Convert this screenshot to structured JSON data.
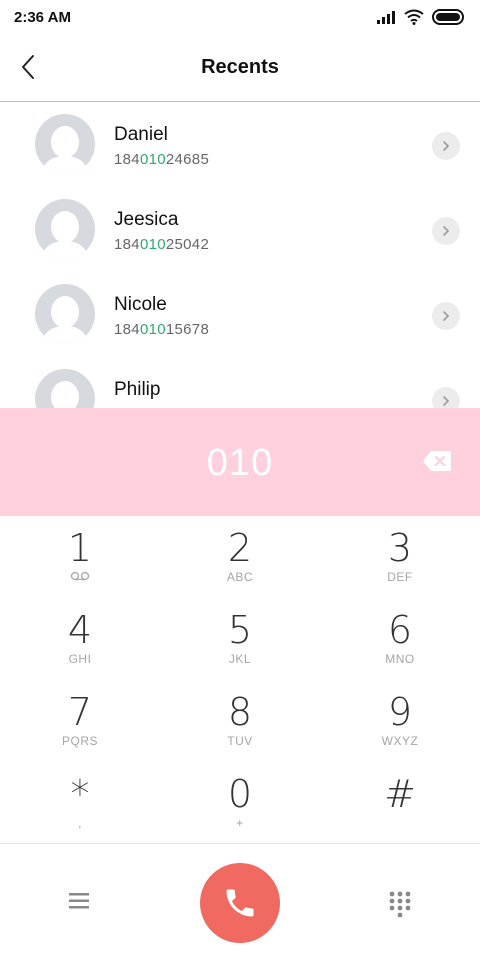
{
  "status_bar": {
    "time": "2:36 AM"
  },
  "header": {
    "title": "Recents"
  },
  "contacts": [
    {
      "name": "Daniel",
      "number_pre": "184",
      "number_match": "010",
      "number_post": "24685"
    },
    {
      "name": "Jeesica",
      "number_pre": "184",
      "number_match": "010",
      "number_post": "25042"
    },
    {
      "name": "Nicole",
      "number_pre": "184",
      "number_match": "010",
      "number_post": "15678"
    },
    {
      "name": "Philip",
      "number_pre": "",
      "number_match": "",
      "number_post": ""
    }
  ],
  "dial": {
    "number": "010"
  },
  "keypad": [
    {
      "digit": "1",
      "letters": ""
    },
    {
      "digit": "2",
      "letters": "ABC"
    },
    {
      "digit": "3",
      "letters": "DEF"
    },
    {
      "digit": "4",
      "letters": "GHI"
    },
    {
      "digit": "5",
      "letters": "JKL"
    },
    {
      "digit": "6",
      "letters": "MNO"
    },
    {
      "digit": "7",
      "letters": "PQRS"
    },
    {
      "digit": "8",
      "letters": "TUV"
    },
    {
      "digit": "9",
      "letters": "WXYZ"
    },
    {
      "digit": "*",
      "letters": ","
    },
    {
      "digit": "0",
      "letters": "+"
    },
    {
      "digit": "#",
      "letters": ""
    }
  ],
  "colors": {
    "accent_pink": "#ffd1dc",
    "call_button": "#f06a61",
    "match_highlight": "#2eaa6e",
    "divider": "#f0a8b4"
  },
  "icons": {
    "key1_sub": "voicemail-icon",
    "back": "chevron-left-icon",
    "backspace": "backspace-icon",
    "menu": "menu-icon",
    "call": "phone-icon",
    "dialpad": "dialpad-icon"
  }
}
